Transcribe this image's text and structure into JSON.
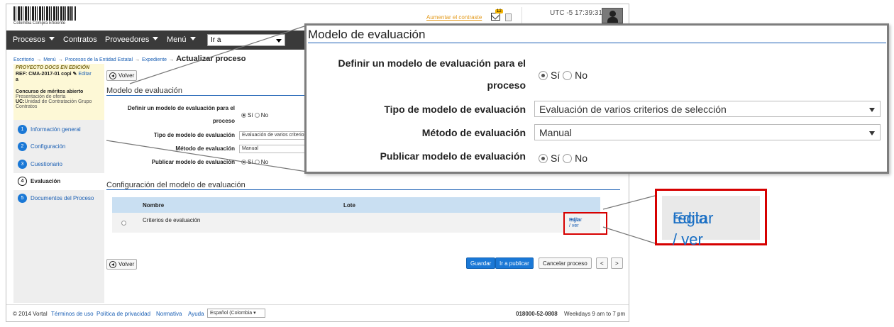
{
  "header": {
    "logo_text": "Colombia Compra Eficiente",
    "contrast_link": "Aumentar el contraste",
    "mail_badge": "12",
    "clock": "UTC -5 17:39:31"
  },
  "nav": {
    "items": [
      "Procesos",
      "Contratos",
      "Proveedores",
      "Menú"
    ],
    "goto_value": "Ir a"
  },
  "breadcrumb": {
    "items": [
      "Escritorio",
      "Menú",
      "Procesos de la Entidad Estatal",
      "Expediente"
    ],
    "current": "Actualizar proceso"
  },
  "project": {
    "status": "PROYECTO DOCS EN EDICIÓN",
    "ref": "REF: CMA-2017-01 copi",
    "ref_cont": "a",
    "edit_label": "Editar",
    "type": "Concurso de méritos abierto",
    "phase": "Presentación de oferta",
    "uc_label": "UC:",
    "uc_value": "Unidad de Contratación Grupo Contratos"
  },
  "steps": [
    {
      "num": "1",
      "label": "Información general"
    },
    {
      "num": "2",
      "label": "Configuración"
    },
    {
      "num": "3",
      "label": "Cuestionario"
    },
    {
      "num": "4",
      "label": "Evaluación"
    },
    {
      "num": "5",
      "label": "Documentos del Proceso"
    }
  ],
  "form": {
    "back_label": "Volver",
    "section_title": "Modelo de evaluación",
    "define_label_1": "Definir un modelo de evaluación para el",
    "define_label_2": "proceso",
    "yes": "Sí",
    "no": "No",
    "type_label": "Tipo de modelo de evaluación",
    "type_value": "Evaluación de varios criterios de selección",
    "method_label": "Método de evaluación",
    "method_value": "Manual",
    "publish_label": "Publicar modelo de evaluación"
  },
  "config": {
    "section_title": "Configuración del modelo de evaluación",
    "col_name": "Nombre",
    "col_lot": "Lote",
    "row_name": "Criterios de evaluación",
    "edit_rule_1": "Editar / ver",
    "edit_rule_2": "regla"
  },
  "actions": {
    "save": "Guardar",
    "publish": "Ir a publicar",
    "cancel": "Cancelar proceso",
    "prev": "<",
    "next": ">"
  },
  "footer": {
    "copyright": "© 2014 Vortal",
    "terms": "Términos de uso",
    "privacy": "Política de privacidad",
    "rules": "Normativa",
    "help": "Ayuda",
    "language": "Español (Colombia",
    "phone": "018000-52-0808",
    "hours": "Weekdays 9 am to 7 pm"
  },
  "colors": {
    "primary": "#1a78d6",
    "link": "#1a5fb4",
    "highlight_border": "#d60000",
    "project_bg": "#fdf8d6",
    "navbar": "#3a3a3a"
  },
  "icons": [
    "back-arrow-icon",
    "mail-icon",
    "document-icon",
    "user-avatar-icon",
    "pencil-icon",
    "chevron-down-icon",
    "radio-button-icon"
  ]
}
